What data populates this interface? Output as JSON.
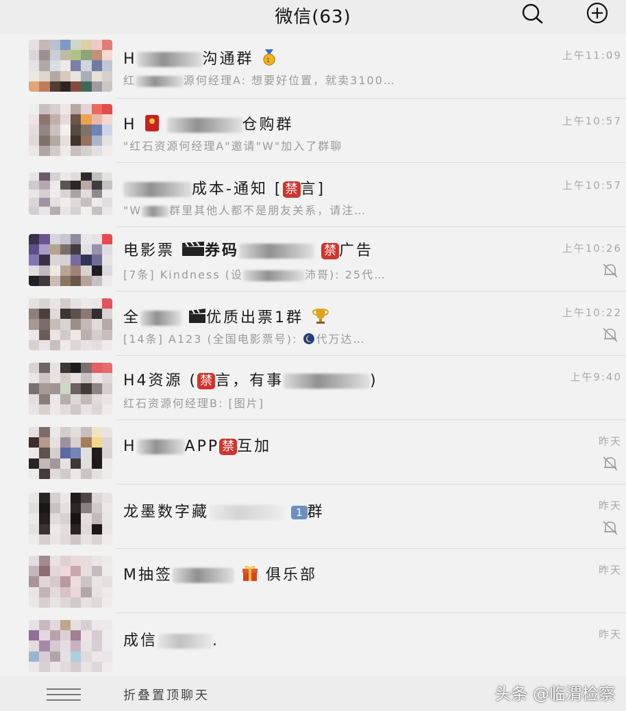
{
  "header": {
    "title": "微信(63)",
    "search_icon": "search-icon",
    "add_icon": "plus-circle-icon"
  },
  "chats": [
    {
      "name": "H",
      "name_tail": "沟通群",
      "preview": "红",
      "preview_tail": "源何经理A: 想要好位置，就卖3100…",
      "time": "上午11:09",
      "muted": false
    },
    {
      "name": "H",
      "name_tail": "仓购群",
      "preview": "\"红石资源何经理A\"邀请\"W\"加入了群聊",
      "time": "上午10:57",
      "muted": false
    },
    {
      "name": "",
      "name_tail": "成本-通知 [",
      "ban": "禁",
      "name_end": "言]",
      "preview": "\"W",
      "preview_tail": "群里其他人都不是朋友关系，请注…",
      "time": "上午10:57",
      "muted": false
    },
    {
      "name": "电影票",
      "name_mid": "券码",
      "ban": "禁",
      "name_end": "广告",
      "preview": "[7条] Kindness (设",
      "preview_tail": "沛哥): 25代…",
      "time": "上午10:26",
      "muted": true
    },
    {
      "name": "全",
      "name_tail": "优质出票1群",
      "preview": "[14条] A123 (全国电影票号): ",
      "preview_tail": "代万达…",
      "time": "上午10:22",
      "muted": true
    },
    {
      "name": "H4资源 (",
      "ban": "禁",
      "name_end": "言，有事",
      "name_close": ")",
      "preview": "红石资源何经理B: [图片]",
      "time": "上午9:40",
      "muted": false
    },
    {
      "name": "H",
      "name_tail": "APP",
      "ban": "禁",
      "name_end": "互加",
      "preview": "",
      "time": "昨天",
      "muted": true
    },
    {
      "name": "龙墨数字藏",
      "badge": "1",
      "name_end": "群",
      "preview": "",
      "time": "昨天",
      "muted": true
    },
    {
      "name": "M抽签",
      "name_end": "俱乐部",
      "preview": "",
      "time": "昨天",
      "muted": false
    },
    {
      "name": "成信",
      "name_tail": ".",
      "preview": "",
      "time": "昨天",
      "muted": false
    }
  ],
  "footer": {
    "label": "折叠置顶聊天",
    "watermark": "头条 @临渭检察"
  },
  "colors": {
    "ban_badge": "#d0342c",
    "list_bg": "#f2f2f2",
    "time_text": "#a8a8a8",
    "preview_text": "#9a9a9a"
  }
}
